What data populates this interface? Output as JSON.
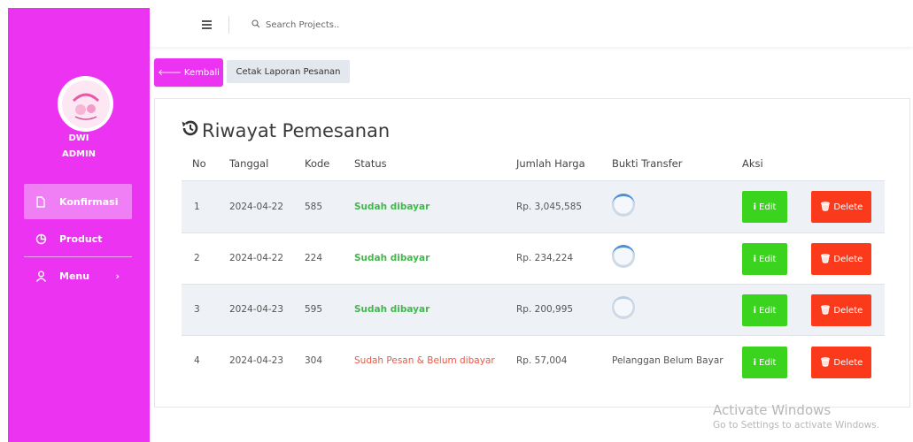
{
  "topbar": {
    "search_placeholder": "Search Projects.."
  },
  "sidebar": {
    "user_first": "DWI",
    "user_role": "ADMIN",
    "items": [
      {
        "label": "Konfirmasi",
        "icon": "file-icon",
        "active": true
      },
      {
        "label": "Product",
        "icon": "pie-chart-icon",
        "active": false
      },
      {
        "label": "Menu",
        "icon": "user-icon",
        "active": false
      }
    ]
  },
  "actions": {
    "back_label": "Kembali",
    "print_label": "Cetak Laporan Pesanan"
  },
  "card": {
    "title": "Riwayat Pemesanan"
  },
  "table": {
    "headers": [
      "No",
      "Tanggal",
      "Kode",
      "Status",
      "Jumlah Harga",
      "Bukti Transfer",
      "Aksi"
    ],
    "rows": [
      {
        "no": "1",
        "tanggal": "2024-04-22",
        "kode": "585",
        "status": "Sudah dibayar",
        "paid": true,
        "jumlah": "Rp. 3,045,585",
        "bukti": ""
      },
      {
        "no": "2",
        "tanggal": "2024-04-22",
        "kode": "224",
        "status": "Sudah dibayar",
        "paid": true,
        "jumlah": "Rp. 234,224",
        "bukti": ""
      },
      {
        "no": "3",
        "tanggal": "2024-04-23",
        "kode": "595",
        "status": "Sudah dibayar",
        "paid": true,
        "jumlah": "Rp. 200,995",
        "bukti": ""
      },
      {
        "no": "4",
        "tanggal": "2024-04-23",
        "kode": "304",
        "status": "Sudah Pesan & Belum dibayar",
        "paid": false,
        "jumlah": "Rp. 57,004",
        "bukti": "Pelanggan Belum Bayar"
      }
    ],
    "edit_label": "Edit",
    "delete_label": "Delete"
  },
  "watermark": {
    "line1": "Activate Windows",
    "line2": "Go to Settings to activate Windows."
  },
  "colors": {
    "brand": "#ec33f2",
    "paid": "#41b94a",
    "unpaid": "#f05545",
    "edit": "#3ad41f",
    "delete": "#fb3a1c"
  }
}
